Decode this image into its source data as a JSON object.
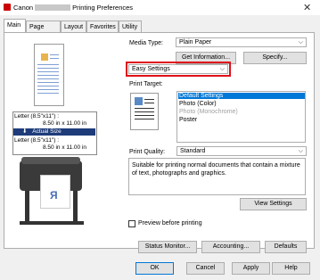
{
  "window": {
    "title_prefix": "Canon",
    "title_suffix": "Printing Preferences",
    "close_glyph": "✕"
  },
  "tabs": [
    {
      "label": "Main"
    },
    {
      "label": "Page Setup"
    },
    {
      "label": "Layout"
    },
    {
      "label": "Favorites"
    },
    {
      "label": "Utility"
    }
  ],
  "paper_info": {
    "line1": "Letter (8.5\"x11\") :",
    "line2": "8.50 in x 11.00 in",
    "actual_size": "Actual Size",
    "line3": "Letter (8.5\"x11\") :",
    "line4": "8.50 in x 11.00 in"
  },
  "media_type": {
    "label": "Media Type:",
    "value": "Plain Paper"
  },
  "buttons": {
    "get_information": "Get Information...",
    "specify": "Specify...",
    "view_settings": "View Settings",
    "status_monitor": "Status Monitor...",
    "accounting": "Accounting...",
    "defaults": "Defaults",
    "ok": "OK",
    "cancel": "Cancel",
    "apply": "Apply",
    "help": "Help"
  },
  "settings_mode": {
    "value": "Easy Settings"
  },
  "print_target": {
    "label": "Print Target:",
    "items": [
      {
        "label": "Default Settings"
      },
      {
        "label": "Photo (Color)"
      },
      {
        "label": "Photo (Monochrome)"
      },
      {
        "label": "Poster"
      }
    ]
  },
  "print_quality": {
    "label": "Print Quality:",
    "value": "Standard"
  },
  "description": "Suitable for printing normal documents that contain a mixture of text, photographs and graphics.",
  "preview_before_printing": {
    "label": "Preview before printing",
    "checked": false
  },
  "colors": {
    "highlight": "#0078d7",
    "callout": "#e0101a",
    "actual_size_bar": "#1e3c7a"
  },
  "icons": [
    "printer-app-icon",
    "close-icon",
    "dropdown-arrow-icon",
    "page-preview-icon",
    "printer-illustration-icon",
    "print-target-icon"
  ]
}
